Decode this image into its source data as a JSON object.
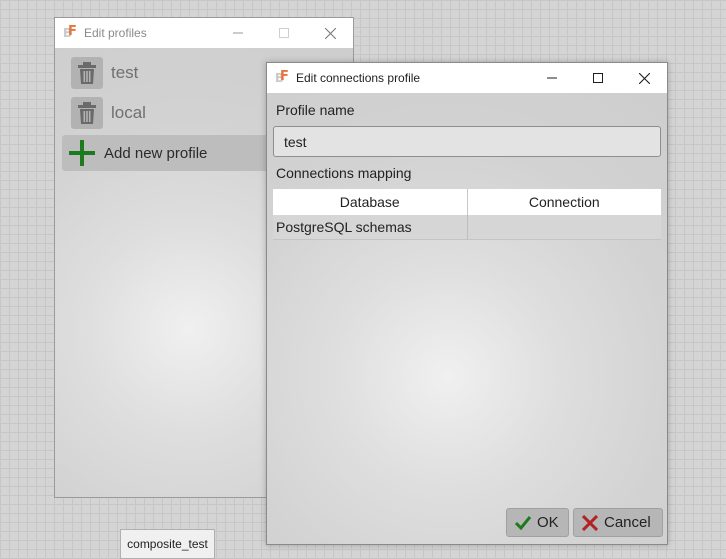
{
  "profiles_window": {
    "title": "Edit profiles",
    "profiles": [
      {
        "label": "test"
      },
      {
        "label": "local"
      }
    ],
    "add_label": "Add new profile",
    "icons": {
      "delete": "trash-icon",
      "add": "plus-icon"
    }
  },
  "conn_window": {
    "title": "Edit connections profile",
    "profile_name_label": "Profile name",
    "profile_name_value": "test",
    "mapping_label": "Connections mapping",
    "table": {
      "columns": [
        "Database",
        "Connection"
      ],
      "rows": [
        [
          "PostgreSQL schemas",
          ""
        ]
      ]
    },
    "ok_label": "OK",
    "cancel_label": "Cancel"
  },
  "canvas": {
    "node_label": "composite_test"
  },
  "colors": {
    "ok_check": "#1f7a1f",
    "cancel_x": "#b22222",
    "add_plus": "#1e7a1e",
    "logo_accent": "#e8743b"
  }
}
